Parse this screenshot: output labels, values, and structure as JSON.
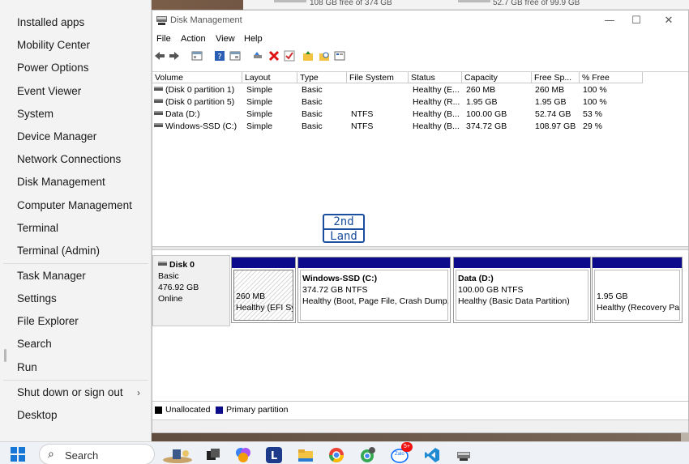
{
  "background_window": {
    "free_left": "108 GB free of 374 GB",
    "free_right": "52.7 GB free of 99.9 GB"
  },
  "winx_menu": {
    "items": [
      {
        "label": "Installed apps",
        "name": "installed-apps"
      },
      {
        "label": "Mobility Center",
        "name": "mobility-center"
      },
      {
        "label": "Power Options",
        "name": "power-options"
      },
      {
        "label": "Event Viewer",
        "name": "event-viewer"
      },
      {
        "label": "System",
        "name": "system"
      },
      {
        "label": "Device Manager",
        "name": "device-manager"
      },
      {
        "label": "Network Connections",
        "name": "network-connections"
      },
      {
        "label": "Disk Management",
        "name": "disk-management"
      },
      {
        "label": "Computer Management",
        "name": "computer-management"
      },
      {
        "label": "Terminal",
        "name": "terminal"
      },
      {
        "label": "Terminal (Admin)",
        "name": "terminal-admin"
      },
      {
        "label": "Task Manager",
        "name": "task-manager"
      },
      {
        "label": "Settings",
        "name": "settings"
      },
      {
        "label": "File Explorer",
        "name": "file-explorer"
      },
      {
        "label": "Search",
        "name": "search"
      },
      {
        "label": "Run",
        "name": "run"
      },
      {
        "label": "Shut down or sign out",
        "name": "shut-down-or-sign-out"
      },
      {
        "label": "Desktop",
        "name": "desktop"
      }
    ],
    "submenu_arrow": "›"
  },
  "window": {
    "title": "Disk Management",
    "minimize": "—",
    "maximize": "☐",
    "close": "✕",
    "menu": [
      "File",
      "Action",
      "View",
      "Help"
    ]
  },
  "volume_list": {
    "columns": [
      "Volume",
      "Layout",
      "Type",
      "File System",
      "Status",
      "Capacity",
      "Free Sp...",
      "% Free"
    ],
    "rows": [
      [
        "(Disk 0 partition 1)",
        "Simple",
        "Basic",
        "",
        "Healthy (E...",
        "260 MB",
        "260 MB",
        "100 %"
      ],
      [
        "(Disk 0 partition 5)",
        "Simple",
        "Basic",
        "",
        "Healthy (R...",
        "1.95 GB",
        "1.95 GB",
        "100 %"
      ],
      [
        "Data (D:)",
        "Simple",
        "Basic",
        "NTFS",
        "Healthy (B...",
        "100.00 GB",
        "52.74 GB",
        "53 %"
      ],
      [
        "Windows-SSD (C:)",
        "Simple",
        "Basic",
        "NTFS",
        "Healthy (B...",
        "374.72 GB",
        "108.97 GB",
        "29 %"
      ]
    ]
  },
  "watermark": {
    "line1": "2nd",
    "line2": "Land"
  },
  "disk": {
    "name": "Disk 0",
    "type": "Basic",
    "size": "476.92 GB",
    "state": "Online"
  },
  "partitions": [
    {
      "title": "",
      "size": "260 MB",
      "status": "Healthy (EFI Sy"
    },
    {
      "title": "Windows-SSD  (C:)",
      "size": "374.72 GB NTFS",
      "status": "Healthy (Boot, Page File, Crash Dump,"
    },
    {
      "title": "Data  (D:)",
      "size": "100.00 GB NTFS",
      "status": "Healthy (Basic Data Partition)"
    },
    {
      "title": "",
      "size": "1.95 GB",
      "status": "Healthy (Recovery Pa"
    }
  ],
  "legend": [
    {
      "label": "Unallocated",
      "color": "#000000"
    },
    {
      "label": "Primary partition",
      "color": "#0b0b8c"
    }
  ],
  "taskbar": {
    "search_placeholder": "Search",
    "zalo_badge": "5+",
    "zalo_label": "Zalo"
  }
}
